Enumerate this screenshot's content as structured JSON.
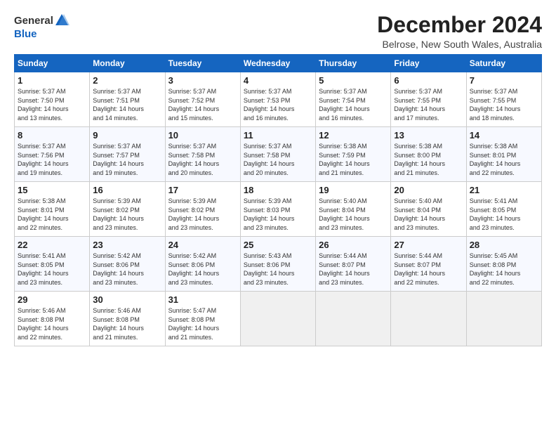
{
  "logo": {
    "general": "General",
    "blue": "Blue"
  },
  "title": "December 2024",
  "location": "Belrose, New South Wales, Australia",
  "days_of_week": [
    "Sunday",
    "Monday",
    "Tuesday",
    "Wednesday",
    "Thursday",
    "Friday",
    "Saturday"
  ],
  "weeks": [
    [
      {
        "num": "1",
        "rise": "5:37 AM",
        "set": "7:50 PM",
        "daylight": "14 hours and 13 minutes."
      },
      {
        "num": "2",
        "rise": "5:37 AM",
        "set": "7:51 PM",
        "daylight": "14 hours and 14 minutes."
      },
      {
        "num": "3",
        "rise": "5:37 AM",
        "set": "7:52 PM",
        "daylight": "14 hours and 15 minutes."
      },
      {
        "num": "4",
        "rise": "5:37 AM",
        "set": "7:53 PM",
        "daylight": "14 hours and 16 minutes."
      },
      {
        "num": "5",
        "rise": "5:37 AM",
        "set": "7:54 PM",
        "daylight": "14 hours and 16 minutes."
      },
      {
        "num": "6",
        "rise": "5:37 AM",
        "set": "7:55 PM",
        "daylight": "14 hours and 17 minutes."
      },
      {
        "num": "7",
        "rise": "5:37 AM",
        "set": "7:55 PM",
        "daylight": "14 hours and 18 minutes."
      }
    ],
    [
      {
        "num": "8",
        "rise": "5:37 AM",
        "set": "7:56 PM",
        "daylight": "14 hours and 19 minutes."
      },
      {
        "num": "9",
        "rise": "5:37 AM",
        "set": "7:57 PM",
        "daylight": "14 hours and 19 minutes."
      },
      {
        "num": "10",
        "rise": "5:37 AM",
        "set": "7:58 PM",
        "daylight": "14 hours and 20 minutes."
      },
      {
        "num": "11",
        "rise": "5:37 AM",
        "set": "7:58 PM",
        "daylight": "14 hours and 20 minutes."
      },
      {
        "num": "12",
        "rise": "5:38 AM",
        "set": "7:59 PM",
        "daylight": "14 hours and 21 minutes."
      },
      {
        "num": "13",
        "rise": "5:38 AM",
        "set": "8:00 PM",
        "daylight": "14 hours and 21 minutes."
      },
      {
        "num": "14",
        "rise": "5:38 AM",
        "set": "8:01 PM",
        "daylight": "14 hours and 22 minutes."
      }
    ],
    [
      {
        "num": "15",
        "rise": "5:38 AM",
        "set": "8:01 PM",
        "daylight": "14 hours and 22 minutes."
      },
      {
        "num": "16",
        "rise": "5:39 AM",
        "set": "8:02 PM",
        "daylight": "14 hours and 23 minutes."
      },
      {
        "num": "17",
        "rise": "5:39 AM",
        "set": "8:02 PM",
        "daylight": "14 hours and 23 minutes."
      },
      {
        "num": "18",
        "rise": "5:39 AM",
        "set": "8:03 PM",
        "daylight": "14 hours and 23 minutes."
      },
      {
        "num": "19",
        "rise": "5:40 AM",
        "set": "8:04 PM",
        "daylight": "14 hours and 23 minutes."
      },
      {
        "num": "20",
        "rise": "5:40 AM",
        "set": "8:04 PM",
        "daylight": "14 hours and 23 minutes."
      },
      {
        "num": "21",
        "rise": "5:41 AM",
        "set": "8:05 PM",
        "daylight": "14 hours and 23 minutes."
      }
    ],
    [
      {
        "num": "22",
        "rise": "5:41 AM",
        "set": "8:05 PM",
        "daylight": "14 hours and 23 minutes."
      },
      {
        "num": "23",
        "rise": "5:42 AM",
        "set": "8:06 PM",
        "daylight": "14 hours and 23 minutes."
      },
      {
        "num": "24",
        "rise": "5:42 AM",
        "set": "8:06 PM",
        "daylight": "14 hours and 23 minutes."
      },
      {
        "num": "25",
        "rise": "5:43 AM",
        "set": "8:06 PM",
        "daylight": "14 hours and 23 minutes."
      },
      {
        "num": "26",
        "rise": "5:44 AM",
        "set": "8:07 PM",
        "daylight": "14 hours and 23 minutes."
      },
      {
        "num": "27",
        "rise": "5:44 AM",
        "set": "8:07 PM",
        "daylight": "14 hours and 22 minutes."
      },
      {
        "num": "28",
        "rise": "5:45 AM",
        "set": "8:08 PM",
        "daylight": "14 hours and 22 minutes."
      }
    ],
    [
      {
        "num": "29",
        "rise": "5:46 AM",
        "set": "8:08 PM",
        "daylight": "14 hours and 22 minutes."
      },
      {
        "num": "30",
        "rise": "5:46 AM",
        "set": "8:08 PM",
        "daylight": "14 hours and 21 minutes."
      },
      {
        "num": "31",
        "rise": "5:47 AM",
        "set": "8:08 PM",
        "daylight": "14 hours and 21 minutes."
      },
      null,
      null,
      null,
      null
    ]
  ],
  "labels": {
    "sunrise": "Sunrise:",
    "sunset": "Sunset:",
    "daylight": "Daylight:"
  }
}
